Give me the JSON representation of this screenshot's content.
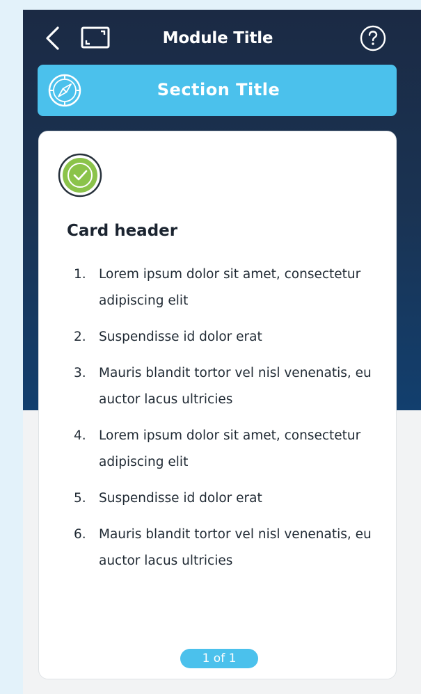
{
  "header": {
    "title": "Module Title",
    "back_icon": "chevron-left-icon",
    "expand_icon": "expand-icon",
    "help_icon": "help-icon"
  },
  "section": {
    "title": "Section Title",
    "icon": "compass-icon"
  },
  "card": {
    "status_icon": "checkmark-icon",
    "header": "Card header",
    "steps": [
      {
        "num": "1.",
        "text": "Lorem ipsum dolor sit amet, consectetur adipiscing elit"
      },
      {
        "num": "2.",
        "text": "Suspendisse id dolor erat"
      },
      {
        "num": "3.",
        "text": "Mauris blandit tortor vel nisl venenatis, eu auctor lacus ultricies"
      },
      {
        "num": "4.",
        "text": "Lorem ipsum dolor sit amet, consectetur adipiscing elit"
      },
      {
        "num": "5.",
        "text": "Suspendisse id dolor erat"
      },
      {
        "num": "6.",
        "text": "Mauris blandit tortor vel nisl venenatis, eu auctor lacus ultricies"
      }
    ],
    "pager": "1 of 1"
  },
  "colors": {
    "header_bg": "#1b2a44",
    "accent": "#4bc1ec",
    "check_green": "#8bc34a",
    "page_bg": "#e3f2fa"
  }
}
